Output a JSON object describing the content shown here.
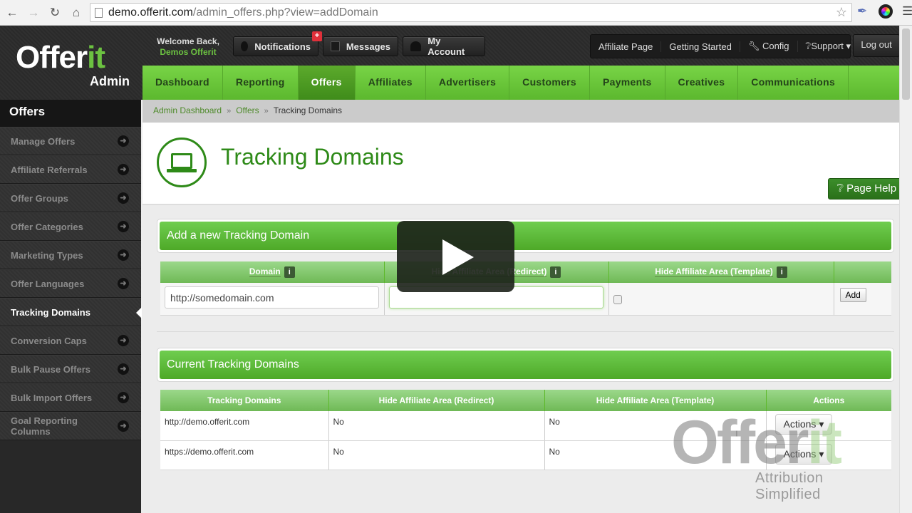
{
  "browser": {
    "url_host": "demo.offerit.com",
    "url_path": "/admin_offers.php?view=addDomain",
    "icons": [
      "back-arrow",
      "forward-arrow",
      "reload",
      "home",
      "page",
      "star",
      "eyedropper",
      "color-wheel",
      "menu"
    ]
  },
  "header": {
    "logo_text_main": "Offer",
    "logo_text_accent": "it",
    "logo_sub": "Admin",
    "welcome_line1": "Welcome Back,",
    "welcome_user": "Demos Offerit",
    "buttons": [
      {
        "label": "Notifications",
        "icon": "chat-bubble-icon",
        "badge": "+"
      },
      {
        "label": "Messages",
        "icon": "envelope-icon"
      },
      {
        "label": "My Account",
        "icon": "user-icon"
      }
    ],
    "right_menu": [
      {
        "label": "Affiliate Page"
      },
      {
        "label": "Getting Started"
      },
      {
        "label": "Config",
        "icon": "wrench-icon"
      },
      {
        "label": "Support",
        "icon": "question-circle-icon",
        "dropdown": true
      }
    ],
    "logout_label": "Log out"
  },
  "main_nav": {
    "tabs": [
      {
        "label": "Dashboard"
      },
      {
        "label": "Reporting"
      },
      {
        "label": "Offers",
        "active": true
      },
      {
        "label": "Affiliates"
      },
      {
        "label": "Advertisers"
      },
      {
        "label": "Customers"
      },
      {
        "label": "Payments"
      },
      {
        "label": "Creatives"
      },
      {
        "label": "Communications"
      }
    ]
  },
  "sidebar": {
    "title": "Offers",
    "items": [
      {
        "label": "Manage Offers"
      },
      {
        "label": "Affiliate Referrals"
      },
      {
        "label": "Offer Groups"
      },
      {
        "label": "Offer Categories"
      },
      {
        "label": "Marketing Types"
      },
      {
        "label": "Offer Languages"
      },
      {
        "label": "Tracking Domains",
        "active": true
      },
      {
        "label": "Conversion Caps"
      },
      {
        "label": "Bulk Pause Offers"
      },
      {
        "label": "Bulk Import Offers"
      },
      {
        "label": "Goal Reporting Columns"
      }
    ]
  },
  "breadcrumb": {
    "items": [
      "Admin Dashboard",
      "Offers"
    ],
    "current": "Tracking Domains",
    "separator": "»"
  },
  "page": {
    "title": "Tracking Domains",
    "help_label": "Page Help"
  },
  "add_panel": {
    "title": "Add a new Tracking Domain",
    "columns": [
      "Domain",
      "Hide Affiliate Area (Redirect)",
      "Hide Affiliate Area (Template)",
      ""
    ],
    "domain_value": "http://somedomain.com",
    "redirect_value": "",
    "template_checked": false,
    "add_label": "Add"
  },
  "current_panel": {
    "title": "Current Tracking Domains",
    "columns": [
      "Tracking Domains",
      "Hide Affiliate Area (Redirect)",
      "Hide Affiliate Area (Template)",
      "Actions"
    ],
    "rows": [
      {
        "domain": "http://demo.offerit.com",
        "redirect": "No",
        "template": "No",
        "action": "Actions"
      },
      {
        "domain": "https://demo.offerit.com",
        "redirect": "No",
        "template": "No",
        "action": "Actions"
      }
    ]
  },
  "watermark": {
    "main": "Offer",
    "accent": "it",
    "tagline": "Attribution Simplified"
  },
  "colors": {
    "brand_green": "#6cc241",
    "title_green": "#2e8a18",
    "header_dark": "#2c2c2c",
    "badge_red": "#e0303a"
  }
}
